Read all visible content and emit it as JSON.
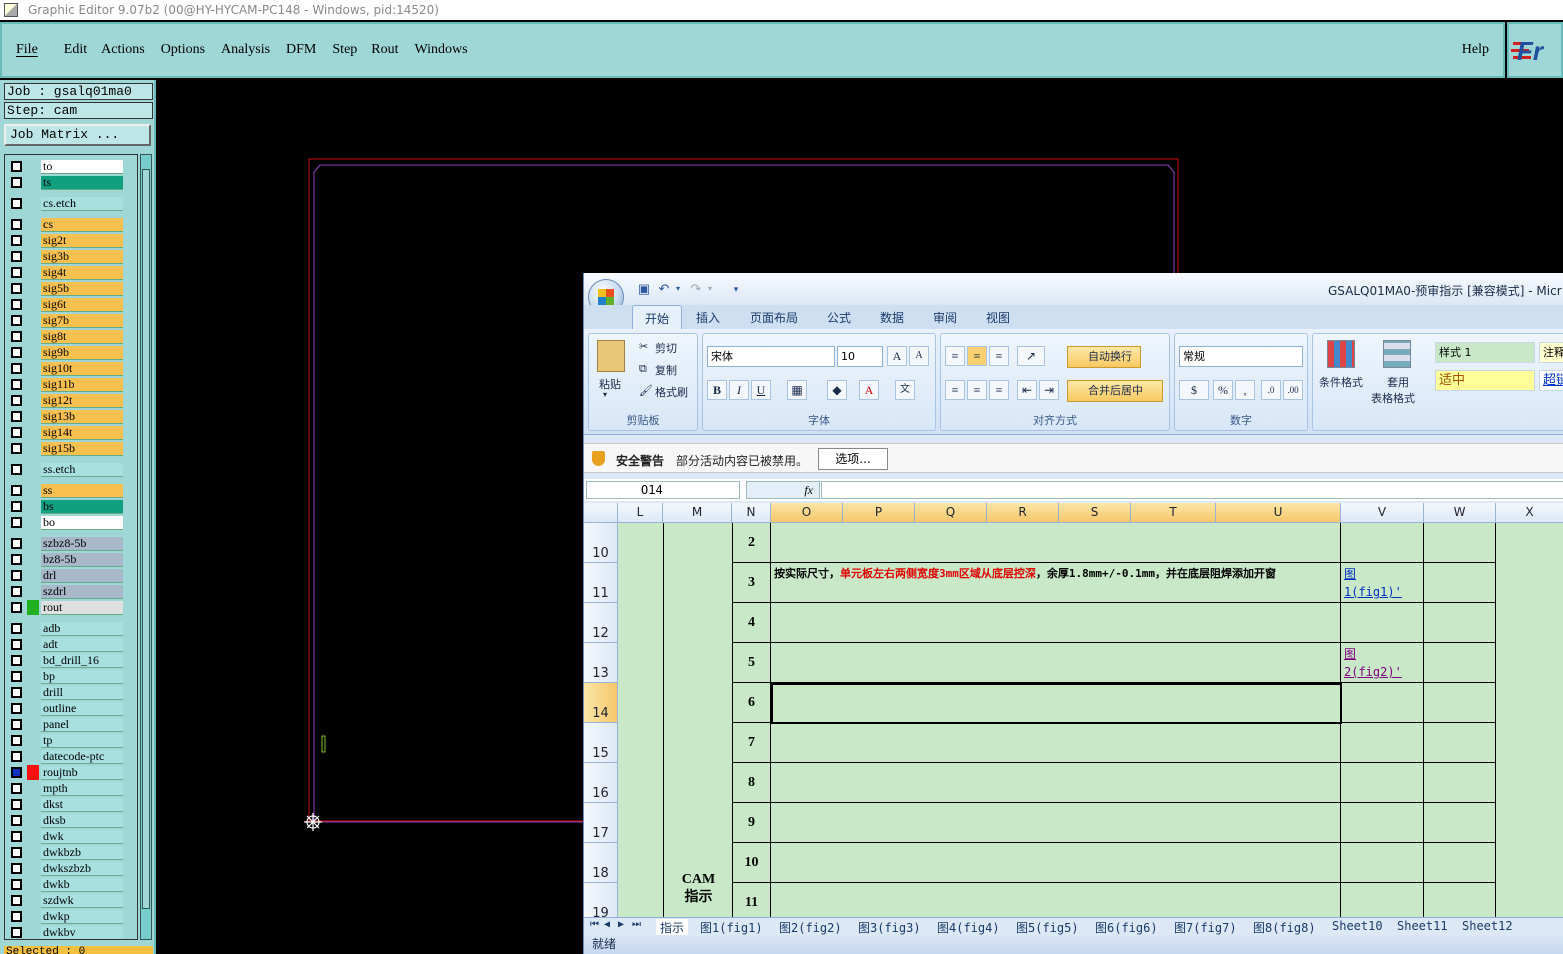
{
  "window": {
    "title": "Graphic Editor 9.07b2 (00@HY-HYCAM-PC148 - Windows, pid:14520)"
  },
  "menubar": {
    "items": [
      "File",
      "Edit",
      "Actions",
      "Options",
      "Analysis",
      "DFM",
      "Step",
      "Rout",
      "Windows"
    ],
    "help": "Help",
    "logo": "Fr"
  },
  "left_panel": {
    "job": "Job : gsalq01ma0",
    "step": "Step: cam",
    "job_matrix": "Job Matrix ...",
    "selected": "Selected : 0",
    "layers": [
      {
        "name": "to",
        "color": "#ffffff"
      },
      {
        "name": "ts",
        "color": "#10a080"
      },
      {
        "name": "cs.etch",
        "color": "#a8e0e0"
      },
      {
        "name": "cs",
        "color": "#f8c050"
      },
      {
        "name": "sig2t",
        "color": "#f8c050"
      },
      {
        "name": "sig3b",
        "color": "#f8c050"
      },
      {
        "name": "sig4t",
        "color": "#f8c050"
      },
      {
        "name": "sig5b",
        "color": "#f8c050"
      },
      {
        "name": "sig6t",
        "color": "#f8c050"
      },
      {
        "name": "sig7b",
        "color": "#f8c050"
      },
      {
        "name": "sig8t",
        "color": "#f8c050"
      },
      {
        "name": "sig9b",
        "color": "#f8c050"
      },
      {
        "name": "sig10t",
        "color": "#f8c050"
      },
      {
        "name": "sig11b",
        "color": "#f8c050"
      },
      {
        "name": "sig12t",
        "color": "#f8c050"
      },
      {
        "name": "sig13b",
        "color": "#f8c050"
      },
      {
        "name": "sig14t",
        "color": "#f8c050"
      },
      {
        "name": "sig15b",
        "color": "#f8c050"
      },
      {
        "name": "ss.etch",
        "color": "#a8e0e0"
      },
      {
        "name": "ss",
        "color": "#f8c050"
      },
      {
        "name": "bs",
        "color": "#10a080"
      },
      {
        "name": "bo",
        "color": "#ffffff"
      },
      {
        "name": "szbz8-5b",
        "color": "#a8b8c8"
      },
      {
        "name": "bz8-5b",
        "color": "#a8b8c8"
      },
      {
        "name": "drl",
        "color": "#a8b8c8"
      },
      {
        "name": "szdrl",
        "color": "#a8b8c8"
      },
      {
        "name": "rout",
        "color": "#e0e0e0"
      },
      {
        "name": "adb",
        "color": "#a8e0e0"
      },
      {
        "name": "adt",
        "color": "#a8e0e0"
      },
      {
        "name": "bd_drill_16",
        "color": "#a8e0e0"
      },
      {
        "name": "bp",
        "color": "#a8e0e0"
      },
      {
        "name": "drill",
        "color": "#a8e0e0"
      },
      {
        "name": "outline",
        "color": "#a8e0e0"
      },
      {
        "name": "panel",
        "color": "#a8e0e0"
      },
      {
        "name": "tp",
        "color": "#a8e0e0"
      },
      {
        "name": "datecode-ptc",
        "color": "#a8e0e0"
      },
      {
        "name": "roujtnb",
        "color": "#a8e0e0"
      },
      {
        "name": "mpth",
        "color": "#a8e0e0"
      },
      {
        "name": "dkst",
        "color": "#a8e0e0"
      },
      {
        "name": "dksb",
        "color": "#a8e0e0"
      },
      {
        "name": "dwk",
        "color": "#a8e0e0"
      },
      {
        "name": "dwkbzb",
        "color": "#a8e0e0"
      },
      {
        "name": "dwkszbzb",
        "color": "#a8e0e0"
      },
      {
        "name": "dwkb",
        "color": "#a8e0e0"
      },
      {
        "name": "szdwk",
        "color": "#a8e0e0"
      },
      {
        "name": "dwkp",
        "color": "#a8e0e0"
      },
      {
        "name": "dwkbv",
        "color": "#a8e0e0"
      }
    ]
  },
  "excel": {
    "title": "GSALQ01MA0-预审指示 [兼容模式] - Micr",
    "tabs": [
      "开始",
      "插入",
      "页面布局",
      "公式",
      "数据",
      "审阅",
      "视图"
    ],
    "ribbon": {
      "paste": "粘贴",
      "cut": "剪切",
      "copy": "复制",
      "format_painter": "格式刷",
      "clipboard": "剪贴板",
      "font_name": "宋体",
      "font_size": "10",
      "font": "字体",
      "wrap_text": "自动换行",
      "merge_center": "合并后居中",
      "alignment": "对齐方式",
      "number_format": "常规",
      "number": "数字",
      "conditional_format": "条件格式",
      "table_format_1": "套用",
      "table_format_2": "表格格式",
      "style1": "样式 1",
      "style_neutral": "适中",
      "style_note": "注释",
      "style_link": "超链"
    },
    "security": {
      "label": "安全警告",
      "message": "部分活动内容已被禁用。",
      "options": "选项..."
    },
    "namebox": "O14",
    "fx": "fx",
    "columns": [
      "L",
      "M",
      "N",
      "O",
      "P",
      "Q",
      "R",
      "S",
      "T",
      "U",
      "V",
      "W",
      "X"
    ],
    "rows": [
      {
        "num": "10",
        "n": "2"
      },
      {
        "num": "11",
        "n": "3"
      },
      {
        "num": "12",
        "n": "4"
      },
      {
        "num": "13",
        "n": "5"
      },
      {
        "num": "14",
        "n": "6"
      },
      {
        "num": "15",
        "n": "7"
      },
      {
        "num": "16",
        "n": "8"
      },
      {
        "num": "17",
        "n": "9"
      },
      {
        "num": "18",
        "n": "10"
      },
      {
        "num": "19",
        "n": "11"
      }
    ],
    "row11_text_a": "按实际尺寸，",
    "row11_text_red": "单元板左右两侧宽度3mm区域从底层控深",
    "row11_text_b": "，余厚1.8mm+/-0.1mm，并在底层阻焊添加开窗",
    "link1_a": "图",
    "link1_b": "1(fig1)'",
    "link2_a": "图",
    "link2_b": "2(fig2)'",
    "cam_label_1": "CAM",
    "cam_label_2": "指示",
    "sheet_tabs": [
      "指示",
      "图1(fig1)",
      "图2(fig2)",
      "图3(fig3)",
      "图4(fig4)",
      "图5(fig5)",
      "图6(fig6)",
      "图7(fig7)",
      "图8(fig8)",
      "Sheet10",
      "Sheet11",
      "Sheet12"
    ],
    "status": "就绪"
  }
}
